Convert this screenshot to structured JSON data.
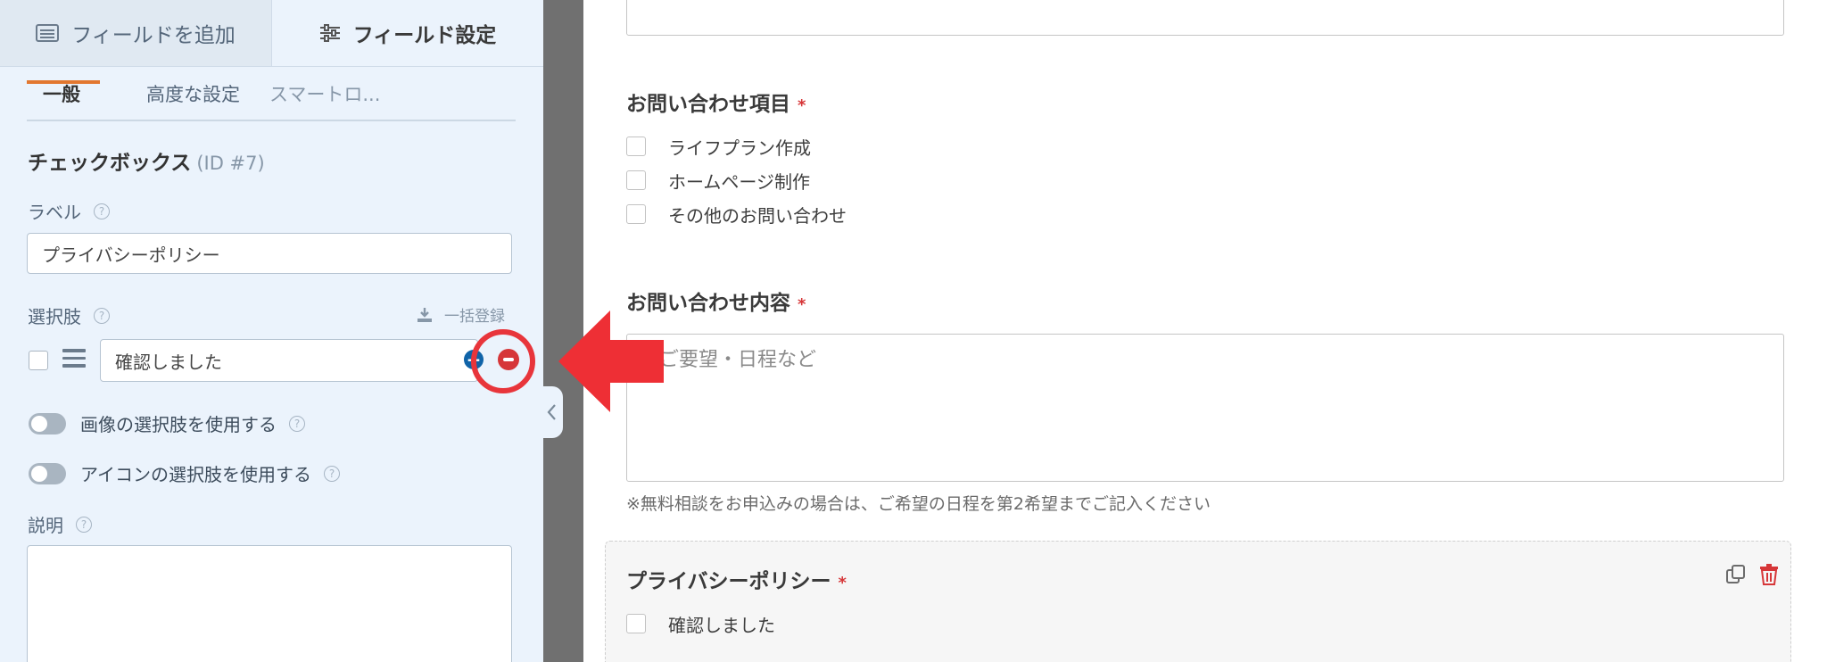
{
  "left_panel": {
    "tabs": {
      "add_field": "フィールドを追加",
      "field_settings": "フィールド設定"
    },
    "subtabs": [
      "一般",
      "高度な設定",
      "スマートロ..."
    ],
    "field_type": "チェックボックス",
    "field_id": "(ID #7)",
    "label_title": "ラベル",
    "label_value": "プライバシーポリシー",
    "choices_title": "選択肢",
    "bulk_add": "一括登録",
    "choices": [
      {
        "label": "確認しました",
        "checked": false
      }
    ],
    "toggles": [
      {
        "label": "画像の選択肢を使用する",
        "on": false
      },
      {
        "label": "アイコンの選択肢を使用する",
        "on": false
      }
    ],
    "description_title": "説明",
    "help_glyph": "?"
  },
  "preview": {
    "inquiry_items": {
      "label": "お問い合わせ項目",
      "required_mark": "*",
      "options": [
        "ライフプラン作成",
        "ホームページ制作",
        "その他のお問い合わせ"
      ]
    },
    "inquiry_content": {
      "label": "お問い合わせ内容",
      "required_mark": "*",
      "placeholder": "ご要望・日程など",
      "description": "※無料相談をお申込みの場合は、ご希望の日程を第2希望までご記入ください"
    },
    "privacy": {
      "label": "プライバシーポリシー",
      "required_mark": "*",
      "option": "確認しました"
    }
  },
  "colors": {
    "panel_bg": "#ebf3fc",
    "accent_orange": "#e27730",
    "danger_red": "#d63638",
    "annotation_red": "#e8353b",
    "add_blue": "#0f63a8",
    "divider_gray": "#707070"
  },
  "icons": [
    "list-icon",
    "sliders-icon",
    "download-icon",
    "drag-handle-icon",
    "add-circle-icon",
    "remove-circle-icon",
    "chevron-left-icon",
    "duplicate-icon",
    "trash-icon",
    "help-icon",
    "annotation-arrow"
  ]
}
